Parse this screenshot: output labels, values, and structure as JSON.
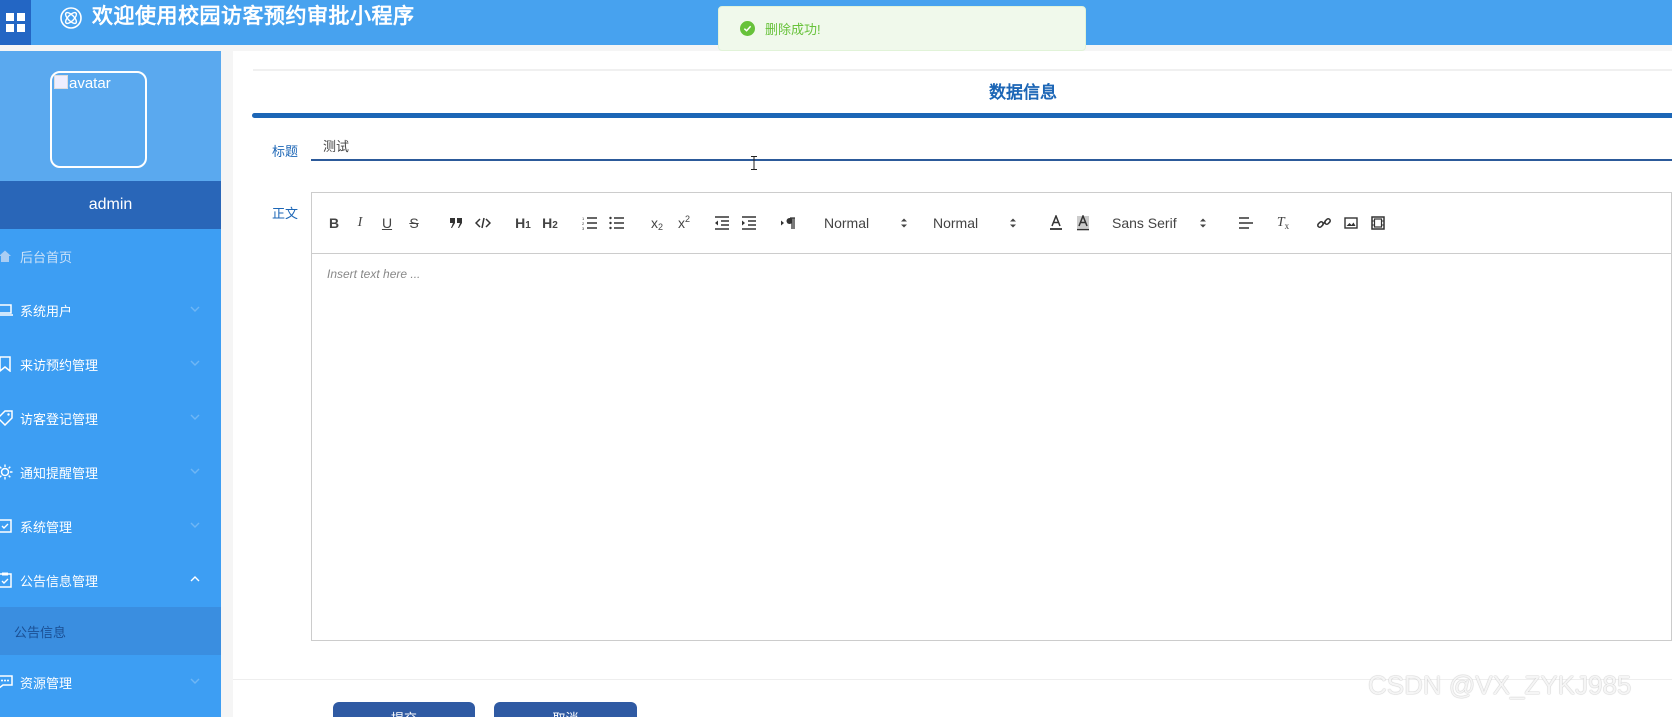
{
  "header": {
    "app_title": "欢迎使用校园访客预约审批小程序"
  },
  "toast": {
    "message": "删除成功!"
  },
  "sidebar": {
    "avatar_alt": "avatar",
    "username": "admin",
    "items": [
      {
        "label": "后台首页",
        "icon": "home-icon"
      },
      {
        "label": "系统用户",
        "icon": "laptop-icon"
      },
      {
        "label": "来访预约管理",
        "icon": "bookmark-icon"
      },
      {
        "label": "访客登记管理",
        "icon": "tag-icon"
      },
      {
        "label": "通知提醒管理",
        "icon": "sun-icon"
      },
      {
        "label": "系统管理",
        "icon": "check-box-icon"
      },
      {
        "label": "公告信息管理",
        "icon": "clipboard-icon"
      },
      {
        "label": "资源管理",
        "icon": "message-icon"
      }
    ],
    "sub_item": "公告信息"
  },
  "main": {
    "section_title": "数据信息",
    "title_label": "标题",
    "title_value": "测试",
    "body_label": "正文",
    "editor": {
      "size_select": "Normal",
      "header_select": "Normal",
      "font_select": "Sans Serif",
      "placeholder": "Insert text here ..."
    },
    "buttons": {
      "submit": "提交",
      "cancel": "取消"
    }
  },
  "watermark": "CSDN @VX_ZYKJ985",
  "colors": {
    "header": "#47a2ef",
    "sidebar": "#3d9ef3",
    "accent": "#1c66b6",
    "success": "#67c23a"
  }
}
